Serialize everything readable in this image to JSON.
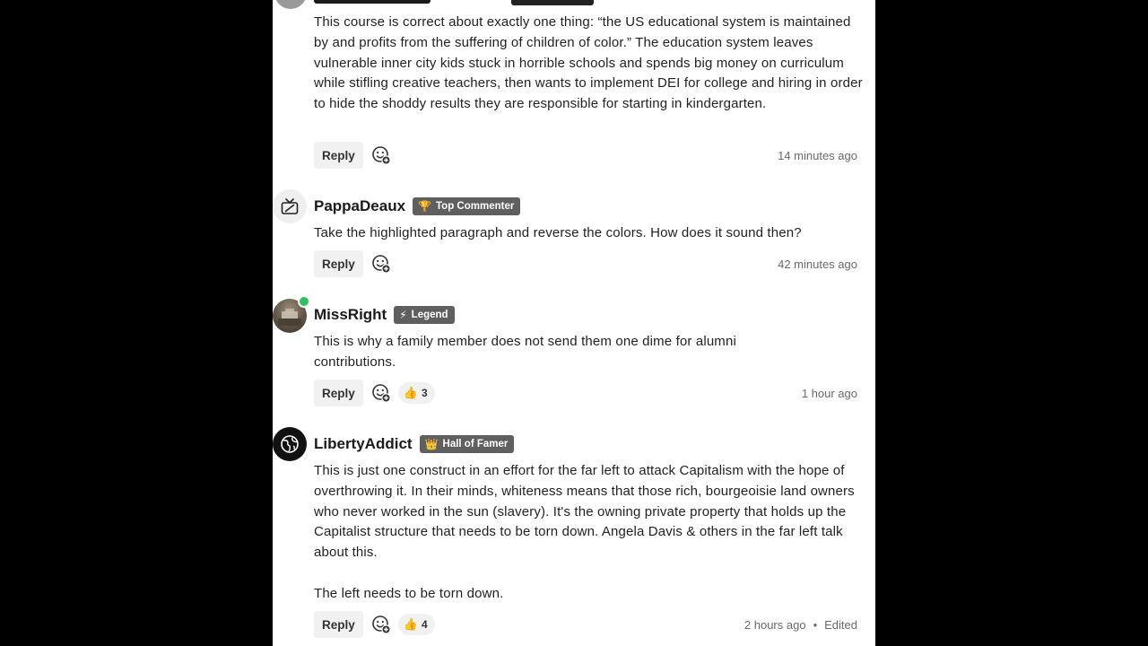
{
  "ui": {
    "reply_label": "Reply",
    "react_icon": "smiley-add-icon",
    "sep": "•"
  },
  "comments": [
    {
      "username": "",
      "badge": null,
      "paragraphs": [
        "This course is correct about exactly one thing: “the US educational system is maintained by and profits from the suffering of children of color.” The education system leaves vulnerable inner city kids stuck in horrible schools and spends big money on curriculum while stifling creative teachers, then wants to implement DEI for college and hiring in order to hide the shoddy results they are responsible for starting in kindergarten."
      ],
      "likes": null,
      "time": "14 minutes ago",
      "edited": null
    },
    {
      "username": "PappaDeaux",
      "avatar_icon": "tv-icon",
      "badge": {
        "label": "Top Commenter",
        "icon": "trophy-icon",
        "glyph": "🏆"
      },
      "paragraphs": [
        "Take the highlighted paragraph and reverse the colors. How does it sound then?"
      ],
      "likes": null,
      "time": "42 minutes ago",
      "edited": null
    },
    {
      "username": "MissRight",
      "avatar_icon": "user-photo",
      "online": true,
      "badge": {
        "label": "Legend",
        "icon": "lightning-icon",
        "glyph": "⚡"
      },
      "paragraphs": [
        "This is why a family member does not send them one dime for alumni contributions."
      ],
      "likes": {
        "icon": "thumbs-up-icon",
        "glyph": "👍",
        "count": "3"
      },
      "time": "1 hour ago",
      "edited": null
    },
    {
      "username": "LibertyAddict",
      "avatar_icon": "globe-icon",
      "badge": {
        "label": "Hall of Famer",
        "icon": "crown-icon",
        "glyph": "👑"
      },
      "paragraphs": [
        "This is just one construct in an effort for the far left to attack Capitalism with the hope of overthrowing it. In their minds, whiteness means that those rich, bourgeoisie land owners who never worked in the sun (slavery). It's the owning private property that holds up the Capitalist structure that needs to be torn down. Angela Davis & others in the far left talk about this.",
        "The left needs to be torn down."
      ],
      "likes": {
        "icon": "thumbs-up-icon",
        "glyph": "👍",
        "count": "4"
      },
      "time": "2 hours ago",
      "edited": "Edited"
    }
  ]
}
